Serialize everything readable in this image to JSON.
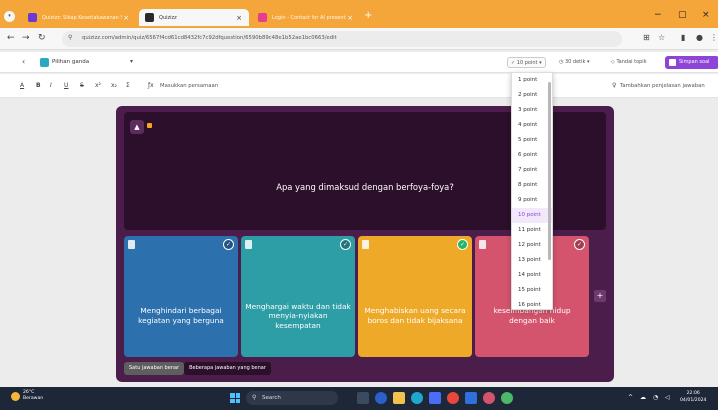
{
  "browser": {
    "tabs": [
      {
        "title": "Quizizz: Sikap Kesetiakawanan Sosi...",
        "active": false,
        "color": "#6a3bd1"
      },
      {
        "title": "Quizizz",
        "active": true,
        "color": "#2b2b2b"
      },
      {
        "title": "Login - Contact for AI presenter",
        "active": false,
        "color": "#e53d8f"
      }
    ],
    "url": "quizizz.com/admin/quiz/6567f4cd61cd8432fc7c92dfquestion/6590b89c48e1b52ae1bc0663/edit",
    "new_tab_icon": "plus-icon"
  },
  "editor_header": {
    "question_type": "Pilihan ganda",
    "points_label": "10 point",
    "time_label": "30 detik",
    "tag_label": "Tandai topik",
    "save_label": "Simpan soal"
  },
  "format_toolbar": {
    "buttons": [
      "A",
      "B",
      "I",
      "U",
      "S",
      "x²",
      "x₂",
      "Σ"
    ],
    "equation_label": "Masukkan persamaan",
    "explanation_label": "Tambahkan penjelasan jawaban"
  },
  "question": {
    "text": "Apa yang dimaksud dengan berfoya-foya?"
  },
  "options": [
    {
      "text": "Menghindari berbagai kegiatan yang berguna",
      "correct": false,
      "color": "#2d70ae"
    },
    {
      "text": "Menghargai waktu dan tidak menyia-nyiakan kesempatan",
      "correct": false,
      "color": "#2d9da6"
    },
    {
      "text": "Menghabiskan uang secara boros dan tidak bijaksana",
      "correct": true,
      "color": "#efa929"
    },
    {
      "text": "keseimbangan hidup dengan baik",
      "correct": false,
      "color": "#d5546d"
    }
  ],
  "answer_mode": {
    "single": "Satu jawaban benar",
    "multiple": "Beberapa jawaban yang benar"
  },
  "points_dropdown": {
    "options": [
      "1 point",
      "2 point",
      "3 point",
      "4 point",
      "5 point",
      "6 point",
      "7 point",
      "8 point",
      "9 point",
      "10 point",
      "11 point",
      "12 point",
      "13 point",
      "14 point",
      "15 point",
      "16 point"
    ],
    "selected": "10 point"
  },
  "taskbar": {
    "weather_temp": "26°C",
    "weather_desc": "Berawan",
    "search_placeholder": "Search",
    "time": "22:06",
    "date": "04/01/2024"
  }
}
